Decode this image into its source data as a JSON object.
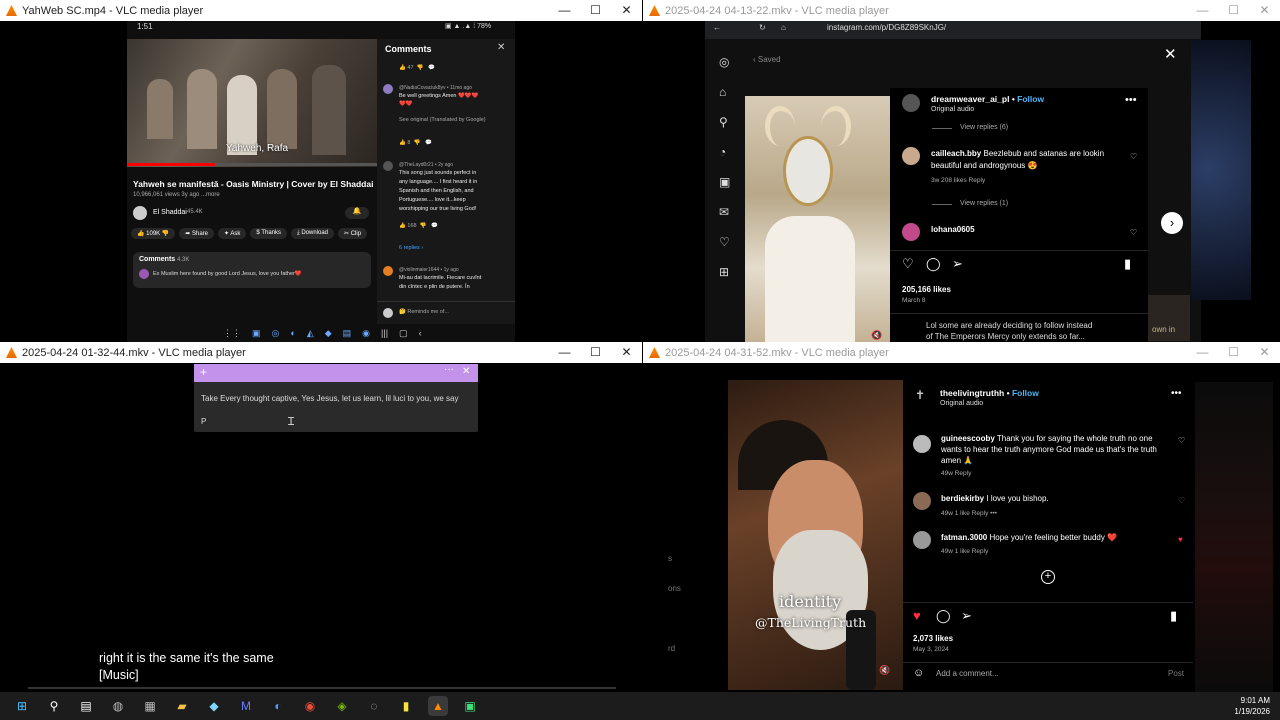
{
  "w1": {
    "title": "YahWeb SC.mp4 - VLC media player",
    "status_time": "1:51",
    "status_icons": "▣ ▲ .▲ ⁞ 78%",
    "video_caption": "Yahweh, Rafa",
    "video_title": "Yahweh se manifestă - Oasis Ministry | Cover by El Shaddai",
    "video_meta": "10,966,061 views 3y ago ...more",
    "channel": "El Shaddai",
    "subs": "45.4K",
    "actions": [
      "109K",
      "Share",
      "Ask",
      "Thanks",
      "Download",
      "Clip"
    ],
    "comments_label": "Comments",
    "comments_count": "4.3K",
    "top_comment": "Ex Muslim here found by good Lord Jesus, love you father❤️",
    "panel_title": "Comments",
    "panel_likes_top": "47",
    "c1_user": "@NadiaCovaciuk8yv • 11mo ago",
    "c1_text_1": "Be well greetings Amen ❤️❤️❤️",
    "c1_text_2": "❤️❤️",
    "c1_see_original": "See original (Translated by Google)",
    "c1_likes": "8",
    "c2_user": "@TheLayd0r21 • 2y ago",
    "c2_lines": [
      "This song just sounds perfect in",
      "any language.... I first heard it in",
      "Spanish and then English, and",
      "Portuguese.... love it...keep",
      "worshipping our true living God!"
    ],
    "c2_likes": "168",
    "replies": "6 replies",
    "c3_user": "@violinmaier1644 • 1y ago",
    "c3_lines": [
      "Mi-au dat lacrimile. Fiecare cuvînt",
      "din cîntec e plin de putere. În"
    ],
    "remind": "🤔 Reminds me of..."
  },
  "w2": {
    "title": "2025-04-24 04-13-22.mkv - VLC media player",
    "url": "instagram.com/p/DG8Z89SKnJG/",
    "saved": "Saved",
    "username": "dreamweaver_ai_pl",
    "follow": "Follow",
    "audio": "Original audio",
    "view_replies_1": "View replies (6)",
    "comment_user": "cailleach.bby",
    "comment_text_1": "Beezlebub and satanas are lookin",
    "comment_text_2": "beautiful and androgynous 😍",
    "comment_meta": "3w   208 likes   Reply",
    "view_replies_2": "View replies (1)",
    "comment2_user": "lohana0605",
    "likes": "205,166 likes",
    "date": "March 8",
    "caption_1": "Lol some are already deciding to follow instead",
    "caption_2": "of The Emperors Mercy only extends so far...",
    "side_text": "own in"
  },
  "w3": {
    "title": "2025-04-24 01-32-44.mkv - VLC media player",
    "note_text": "Take Every thought captive, Yes Jesus, let us learn, lil luci to you, we say",
    "note_input": "P",
    "subtitle_1": "right it is the same it's the same",
    "subtitle_2": "[Music]"
  },
  "w4": {
    "title": "2025-04-24 04-31-52.mkv - VLC media player",
    "username": "theelivingtruthh",
    "follow": "Follow",
    "audio": "Original audio",
    "overlay_1": "identity",
    "overlay_2": "@TheLivingTruth",
    "comments": [
      {
        "user": "guineescooby",
        "text_1": "Thank you for saying the whole truth no one",
        "text_2": "wants to hear the truth anymore God made us that's the truth",
        "text_3": "amen 🙏",
        "meta": "49w   Reply"
      },
      {
        "user": "berdiekirby",
        "text_1": "I love you bishop.",
        "meta": "49w   1 like   Reply   •••"
      },
      {
        "user": "fatman.3000",
        "text_1": "Hope you're feeling better buddy ❤️",
        "meta": "49w   1 like   Reply"
      }
    ],
    "likes": "2,073 likes",
    "date": "May 3, 2024",
    "add_comment": "Add a comment...",
    "post": "Post",
    "left_frag": [
      "s",
      "ons",
      "rd"
    ]
  },
  "taskbar": {
    "time": "9:01 AM",
    "date": "1/19/2026"
  }
}
